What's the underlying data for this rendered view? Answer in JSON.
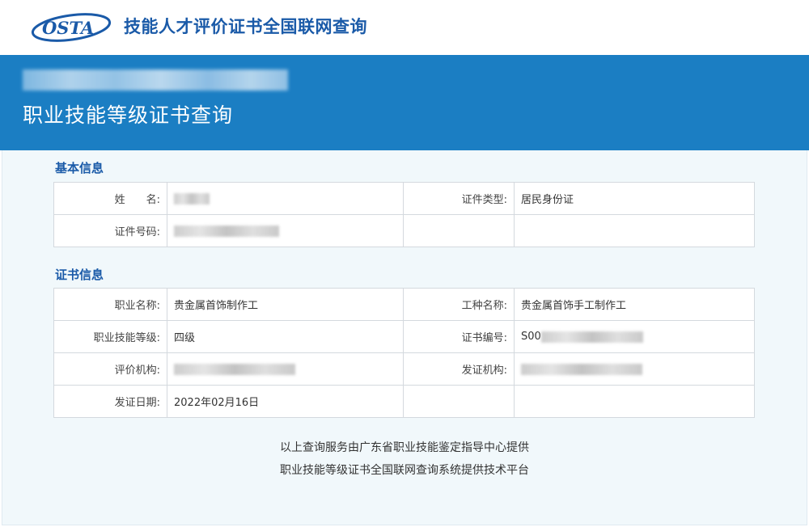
{
  "header": {
    "logo_text": "OSTA",
    "site_title": "技能人才评价证书全国联网查询"
  },
  "banner": {
    "title": "职业技能等级证书查询"
  },
  "basic_info": {
    "section_title": "基本信息",
    "rows": [
      {
        "label1": "姓　　名:",
        "value1": "",
        "label2": "证件类型:",
        "value2": "居民身份证"
      },
      {
        "label1": "证件号码:",
        "value1": "",
        "label2": "",
        "value2": ""
      }
    ]
  },
  "cert_info": {
    "section_title": "证书信息",
    "rows": [
      {
        "label1": "职业名称:",
        "value1": "贵金属首饰制作工",
        "label2": "工种名称:",
        "value2": "贵金属首饰手工制作工"
      },
      {
        "label1": "职业技能等级:",
        "value1": "四级",
        "label2": "证书编号:",
        "value2": "S00"
      },
      {
        "label1": "评价机构:",
        "value1": "",
        "label2": "发证机构:",
        "value2": ""
      },
      {
        "label1": "发证日期:",
        "value1": "2022年02月16日",
        "label2": "",
        "value2": ""
      }
    ]
  },
  "footer": {
    "line1": "以上查询服务由广东省职业技能鉴定指导中心提供",
    "line2": "职业技能等级证书全国联网查询系统提供技术平台"
  },
  "colors": {
    "brand_blue": "#1a5aa8",
    "banner_blue": "#1b7ec3",
    "content_bg": "#f1f8fb"
  }
}
